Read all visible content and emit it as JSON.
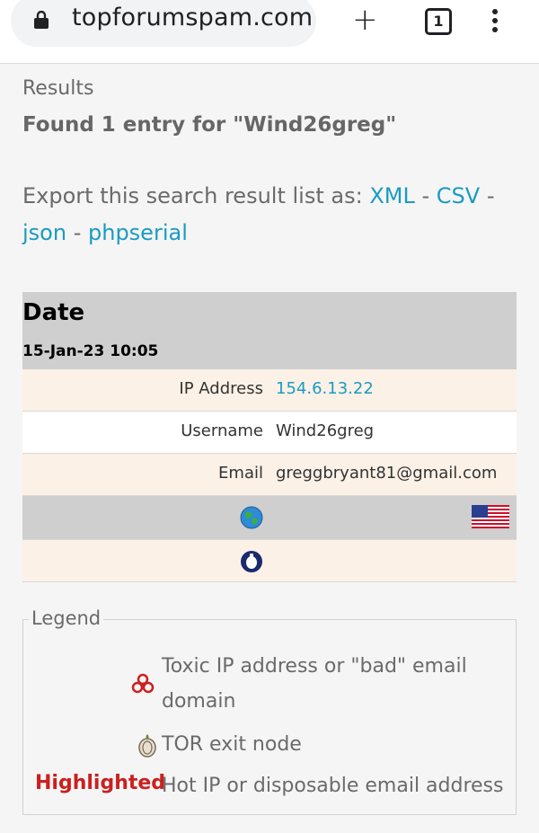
{
  "browser": {
    "url": "topforumspam.com",
    "tab_count": "1"
  },
  "page": {
    "results_label": "Results",
    "found_text": "Found 1 entry for \"Wind26greg\"",
    "export": {
      "prefix": "Export this search result list as:",
      "links": [
        "XML",
        "CSV",
        "json",
        "phpserial"
      ],
      "separator": " - "
    }
  },
  "result": {
    "date_header": "Date",
    "date_value": "15-Jan-23 10:05",
    "rows": [
      {
        "label": "IP Address",
        "value": "154.6.13.22"
      },
      {
        "label": "Username",
        "value": "Wind26greg"
      },
      {
        "label": "Email",
        "value": "greggbryant81@gmail.com"
      }
    ],
    "icons": [
      "globe-icon",
      "us-flag-icon",
      "tor-icon"
    ]
  },
  "legend": {
    "title": "Legend",
    "items": [
      {
        "icon": "biohazard-icon",
        "text_line1": "Toxic IP address or \"bad\" email",
        "text_line2": "domain"
      },
      {
        "icon": "tor-onion-icon",
        "text_line1": "TOR exit node"
      },
      {
        "marker": "Highlighted",
        "text_line1": "Hot IP or disposable email address"
      }
    ]
  },
  "colors": {
    "link": "#1a9bc2",
    "highlight": "#cc1f1f",
    "cream_row": "#fbf1e6",
    "gray_row": "#cfcfcf"
  }
}
